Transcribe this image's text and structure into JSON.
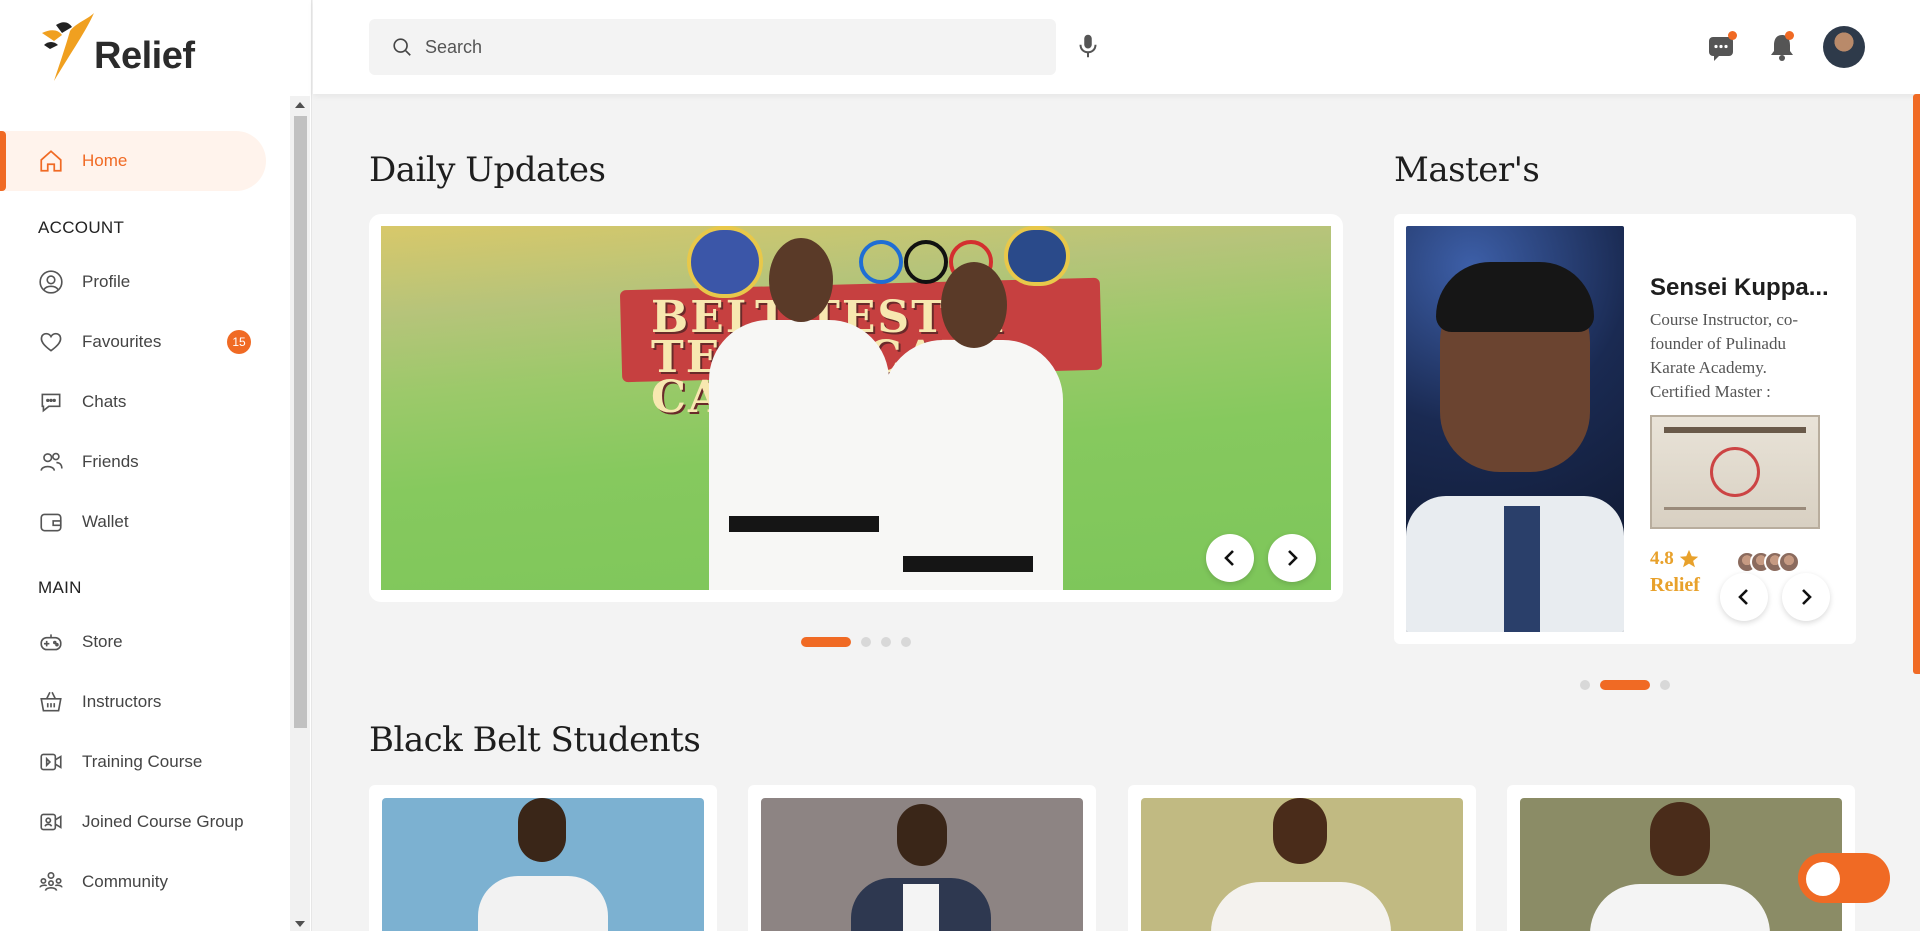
{
  "app": {
    "logo_text": "Relief",
    "accent": "#f06a24"
  },
  "sidebar": {
    "home": "Home",
    "account_label": "ACCOUNT",
    "account_items": [
      {
        "label": "Profile",
        "icon": "user-circle-icon"
      },
      {
        "label": "Favourites",
        "icon": "heart-icon",
        "badge": "15"
      },
      {
        "label": "Chats",
        "icon": "chat-icon"
      },
      {
        "label": "Friends",
        "icon": "friends-icon"
      },
      {
        "label": "Wallet",
        "icon": "wallet-icon"
      }
    ],
    "main_label": "MAIN",
    "main_items": [
      {
        "label": "Store",
        "icon": "gamepad-icon"
      },
      {
        "label": "Instructors",
        "icon": "basket-icon"
      },
      {
        "label": "Training Course",
        "icon": "video-icon"
      },
      {
        "label": "Joined Course Group",
        "icon": "video-group-icon"
      },
      {
        "label": "Community",
        "icon": "community-icon"
      }
    ]
  },
  "header": {
    "search_placeholder": "Search"
  },
  "main": {
    "daily_updates_title": "Daily Updates",
    "banner_text": "BELT TEST & TECHNICAL CAMP",
    "masters_title": "Master's",
    "master": {
      "name": "Sensei Kuppa...",
      "description": "Course Instructor, co-founder of Pulinadu Karate Academy. Certified Master :",
      "rating": "4.8",
      "tag": "Relief"
    },
    "black_belt_title": "Black Belt Students"
  }
}
